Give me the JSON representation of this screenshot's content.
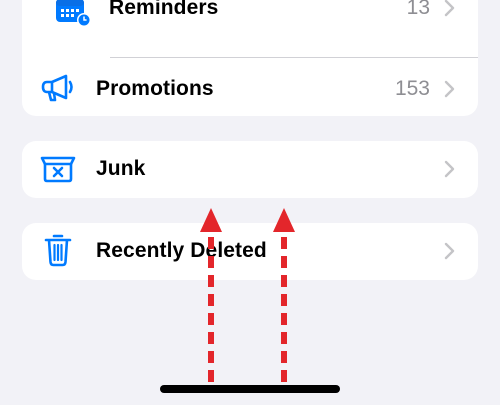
{
  "list": {
    "reminders": {
      "label": "Reminders",
      "count": "13",
      "icon": "calendar-clock-icon"
    },
    "promotions": {
      "label": "Promotions",
      "count": "153",
      "icon": "megaphone-icon"
    },
    "junk": {
      "label": "Junk",
      "icon": "junk-box-icon"
    },
    "recently_deleted": {
      "label": "Recently Deleted",
      "icon": "trash-icon"
    }
  },
  "colors": {
    "background": "#f2f2f7",
    "card": "#ffffff",
    "accent": "#007aff",
    "count": "#8e8e93",
    "chevron": "#c4c4c7",
    "annotation_arrow": "#e3262b"
  },
  "annotations": {
    "arrows": [
      {
        "icon": "swipe-up-arrow-icon"
      },
      {
        "icon": "swipe-up-arrow-icon"
      }
    ]
  }
}
